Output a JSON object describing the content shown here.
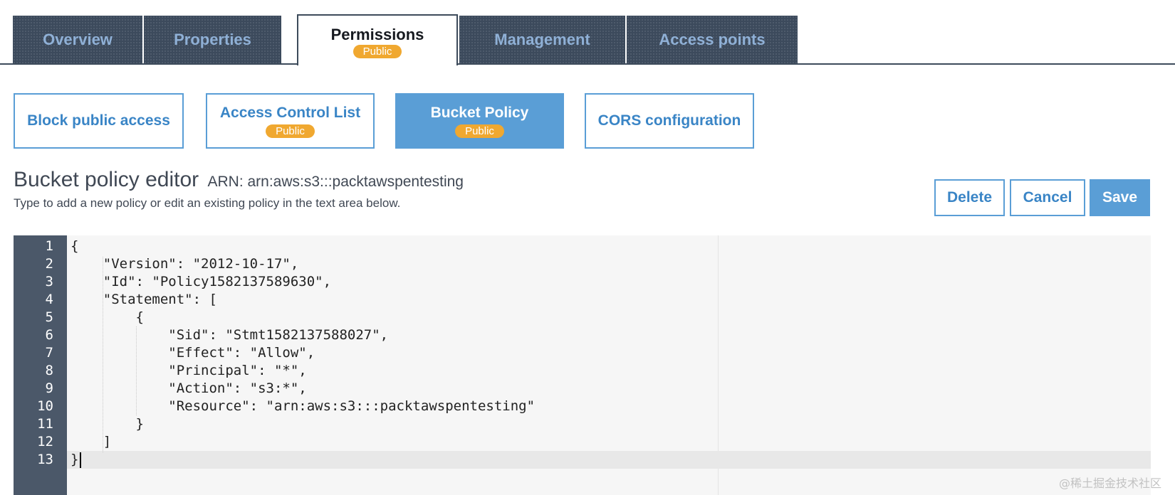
{
  "tabs": [
    {
      "label": "Overview"
    },
    {
      "label": "Properties"
    },
    {
      "label": "Permissions",
      "badge": "Public"
    },
    {
      "label": "Management"
    },
    {
      "label": "Access points"
    }
  ],
  "subtabs": [
    {
      "label": "Block public access"
    },
    {
      "label": "Access Control List",
      "badge": "Public"
    },
    {
      "label": "Bucket Policy",
      "badge": "Public"
    },
    {
      "label": "CORS configuration"
    }
  ],
  "editor": {
    "title": "Bucket policy editor",
    "arn": "ARN: arn:aws:s3:::packtawspentesting",
    "description": "Type to add a new policy or edit an existing policy in the text area below."
  },
  "buttons": {
    "delete": "Delete",
    "cancel": "Cancel",
    "save": "Save"
  },
  "code": {
    "line_numbers": [
      "1",
      "2",
      "3",
      "4",
      "5",
      "6",
      "7",
      "8",
      "9",
      "10",
      "11",
      "12",
      "13"
    ],
    "lines": [
      "{",
      "    \"Version\": \"2012-10-17\",",
      "    \"Id\": \"Policy1582137589630\",",
      "    \"Statement\": [",
      "        {",
      "            \"Sid\": \"Stmt1582137588027\",",
      "            \"Effect\": \"Allow\",",
      "            \"Principal\": \"*\",",
      "            \"Action\": \"s3:*\",",
      "            \"Resource\": \"arn:aws:s3:::packtawspentesting\"",
      "        }",
      "    ]",
      "}"
    ]
  },
  "watermark": "@稀土掘金技术社区",
  "colors": {
    "tab_bg": "#3c4a5c",
    "tab_text": "#8fb0d6",
    "accent": "#5a9ed6",
    "badge": "#f0a830",
    "gutter": "#4b5869"
  }
}
